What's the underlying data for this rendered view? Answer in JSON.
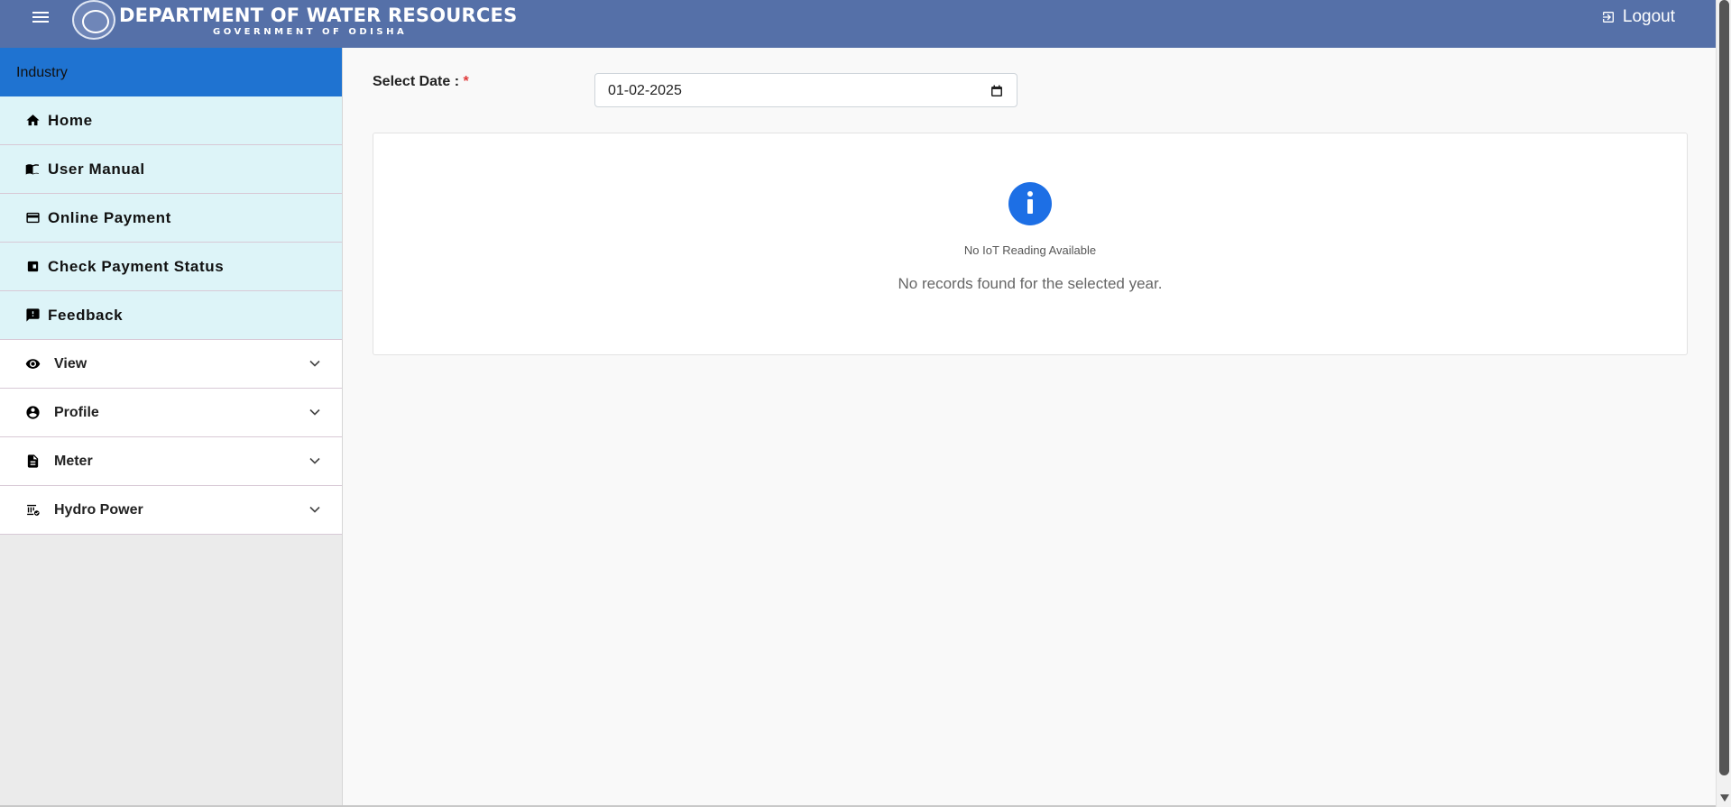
{
  "header": {
    "title": "DEPARTMENT OF WATER RESOURCES",
    "subtitle": "GOVERNMENT OF ODISHA",
    "logout_label": "Logout",
    "menu_icon": "hamburger-icon",
    "background": "#5570a8"
  },
  "sidebar": {
    "heading": "Industry",
    "items": [
      {
        "label": "Home",
        "icon": "home-icon",
        "expandable": false
      },
      {
        "label": "User Manual",
        "icon": "book-icon",
        "expandable": false
      },
      {
        "label": "Online Payment",
        "icon": "credit-card-icon",
        "expandable": false
      },
      {
        "label": "Check Payment Status",
        "icon": "wallet-icon",
        "expandable": false
      },
      {
        "label": "Feedback",
        "icon": "feedback-icon",
        "expandable": false
      },
      {
        "label": "View",
        "icon": "eye-icon",
        "expandable": true
      },
      {
        "label": "Profile",
        "icon": "account-circle-icon",
        "expandable": true
      },
      {
        "label": "Meter",
        "icon": "document-icon",
        "expandable": true
      },
      {
        "label": "Hydro Power",
        "icon": "hydro-power-icon",
        "expandable": true
      }
    ]
  },
  "main": {
    "date_label": "Select Date :",
    "required_mark": "*",
    "date_value": "01-02-2025",
    "empty_state": {
      "title": "No IoT Reading Available",
      "message": "No records found for the selected year.",
      "icon": "info-icon"
    }
  },
  "colors": {
    "accent": "#1f73d1",
    "info": "#1d6fe5",
    "required": "#e03a3a"
  }
}
